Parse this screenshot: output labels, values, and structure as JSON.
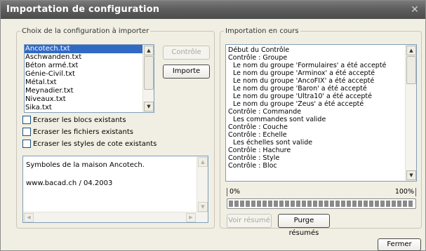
{
  "window": {
    "title": "Importation de configuration",
    "close_glyph": "✕"
  },
  "choix": {
    "legend": "Choix de la configuration à importer",
    "files": [
      "Ancotech.txt",
      "Aschwanden.txt",
      "Béton armé.txt",
      "Génie-Civil.txt",
      "Métal.txt",
      "Meynadier.txt",
      "Niveaux.txt",
      "Sika.txt"
    ],
    "selected_index": 0,
    "buttons": {
      "controle": "Contrôle",
      "importe": "Importe"
    },
    "checkboxes": [
      {
        "label": "Ecraser les blocs existants",
        "checked": false
      },
      {
        "label": "Ecraser les fichiers existants",
        "checked": false
      },
      {
        "label": "Ecraser les styles de cote existants",
        "checked": false
      }
    ],
    "description": [
      "Symboles de la maison Ancotech.",
      "www.bacad.ch / 04.2003"
    ]
  },
  "importation": {
    "legend": "Importation en cours",
    "log": [
      {
        "text": "Début du Contrôle",
        "indent": false
      },
      {
        "text": "Contrôle : Groupe",
        "indent": false
      },
      {
        "text": "Le nom du groupe 'Formulaires' a été accepté",
        "indent": true
      },
      {
        "text": "Le nom du groupe 'Arminox' a été accepté",
        "indent": true
      },
      {
        "text": "Le nom du groupe 'AncoFIX' a été accepté",
        "indent": true
      },
      {
        "text": "Le nom du groupe 'Baron' a été accepté",
        "indent": true
      },
      {
        "text": "Le nom du groupe 'Ultra10' a été accepté",
        "indent": true
      },
      {
        "text": "Le nom du groupe 'Zeus' a été accepté",
        "indent": true
      },
      {
        "text": "Contrôle : Commande",
        "indent": false
      },
      {
        "text": "Les commandes sont valide",
        "indent": true
      },
      {
        "text": "Contrôle : Couche",
        "indent": false
      },
      {
        "text": "Contrôle : Echelle",
        "indent": false
      },
      {
        "text": "Les échelles sont valide",
        "indent": true
      },
      {
        "text": "Contrôle : Hachure",
        "indent": false
      },
      {
        "text": "Contrôle : Style",
        "indent": false
      },
      {
        "text": "Contrôle : Bloc",
        "indent": false
      }
    ],
    "progress": {
      "min_label": "0%",
      "max_label": "100%",
      "value_percent": 100
    },
    "buttons": {
      "voir": "Voir résumé",
      "purge": "Purge résumés"
    }
  },
  "footer": {
    "fermer": "Fermer"
  }
}
